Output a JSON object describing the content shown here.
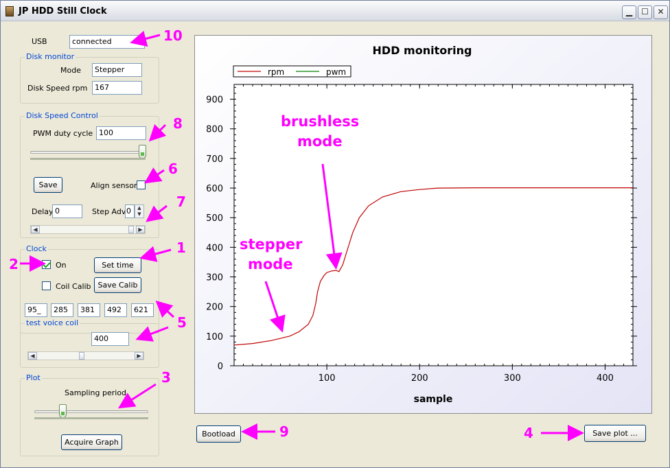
{
  "window": {
    "title": "JP HDD Still Clock"
  },
  "usb": {
    "label": "USB",
    "value": "connected"
  },
  "disk_monitor": {
    "title": "Disk monitor",
    "mode_label": "Mode",
    "mode_value": "Stepper",
    "speed_label": "Disk Speed rpm",
    "speed_value": "167"
  },
  "disk_speed_control": {
    "title": "Disk Speed Control",
    "pwm_label": "PWM duty cycle",
    "pwm_value": "100",
    "pwm_slider_fraction": 1.0,
    "save_label": "Save",
    "align_label": "Align sensor",
    "delay_label": "Delay",
    "delay_value": "0",
    "stepadv_label": "Step Adv",
    "stepadv_value": "0"
  },
  "clock": {
    "title": "Clock",
    "on_label": "On",
    "settime_label": "Set time",
    "coil_label": "Coil Calib",
    "savecalib_label": "Save Calib",
    "values": [
      "95_",
      "285",
      "381",
      "492",
      "621"
    ]
  },
  "voice_coil": {
    "title": "test voice coil",
    "value": "400"
  },
  "plot": {
    "title": "Plot",
    "sampling_label": "Sampling period",
    "acquire_label": "Acquire Graph"
  },
  "bottom": {
    "bootload_label": "Bootload",
    "saveplot_label": "Save plot ..."
  },
  "annotations": {
    "n10": "10",
    "n8": "8",
    "n6": "6",
    "n7": "7",
    "n1": "1",
    "n2": "2",
    "n5": "5",
    "n3": "3",
    "n9": "9",
    "n4": "4",
    "stepper": "stepper",
    "stepper2": "mode",
    "brushless": "brushless",
    "brushless2": "mode"
  },
  "colors": {
    "annotation": "#ff00ff",
    "rpm": "#c00000",
    "pwm": "#008000",
    "group_title": "#0046d5"
  },
  "chart_data": {
    "type": "line",
    "title": "HDD monitoring",
    "xlabel": "sample",
    "ylabel": "",
    "xlim": [
      0,
      430
    ],
    "ylim": [
      0,
      950
    ],
    "xticks": [
      100,
      200,
      300,
      400
    ],
    "yticks": [
      0,
      100,
      200,
      300,
      400,
      500,
      600,
      700,
      800,
      900
    ],
    "legend": "top-left",
    "series": [
      {
        "name": "rpm",
        "color": "#c00000",
        "x": [
          0,
          20,
          40,
          60,
          70,
          80,
          85,
          88,
          90,
          93,
          97,
          100,
          105,
          110,
          113,
          117,
          122,
          128,
          135,
          145,
          160,
          180,
          200,
          220,
          260,
          300,
          350,
          400,
          430
        ],
        "y": [
          70,
          75,
          85,
          100,
          115,
          140,
          170,
          210,
          250,
          285,
          305,
          315,
          320,
          322,
          318,
          340,
          390,
          450,
          500,
          540,
          570,
          588,
          595,
          600,
          601,
          601,
          601,
          601,
          601
        ]
      },
      {
        "name": "pwm",
        "color": "#008000",
        "x": [],
        "y": []
      }
    ]
  }
}
